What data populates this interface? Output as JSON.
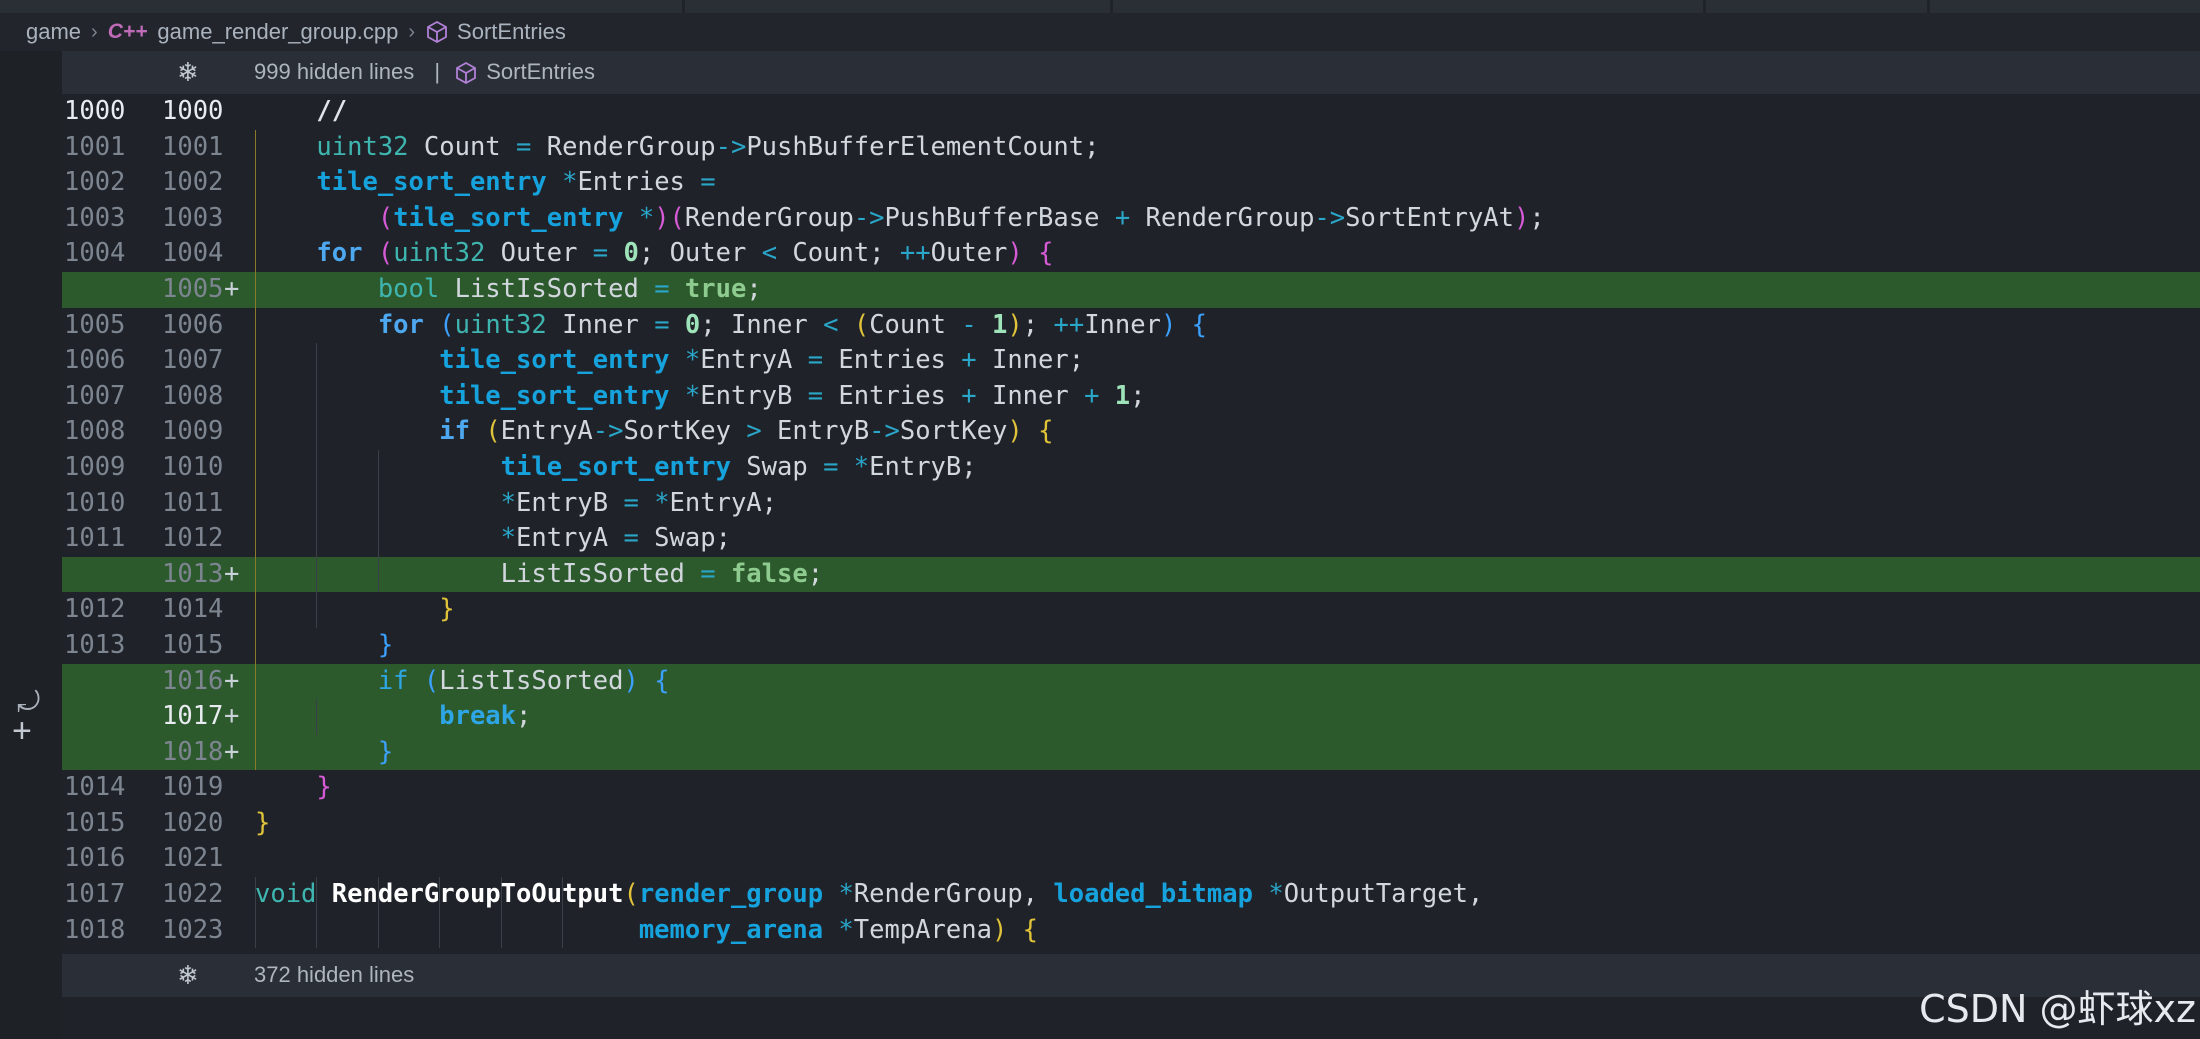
{
  "breadcrumb": {
    "folder": "game",
    "file": "game_render_group.cpp",
    "symbol": "SortEntries",
    "file_icon": "c++-icon",
    "symbol_icon": "cube-icon"
  },
  "fold_top": {
    "label": "999 hidden lines",
    "separator": "|",
    "context": "SortEntries"
  },
  "fold_bottom": {
    "label": "372 hidden lines"
  },
  "code_lines": [
    {
      "old": "1000",
      "new": "1000",
      "added": false,
      "active": true
    },
    {
      "old": "1001",
      "new": "1001",
      "added": false
    },
    {
      "old": "1002",
      "new": "1002",
      "added": false
    },
    {
      "old": "1003",
      "new": "1003",
      "added": false
    },
    {
      "old": "1004",
      "new": "1004",
      "added": false
    },
    {
      "old": "",
      "new": "1005",
      "added": true
    },
    {
      "old": "1005",
      "new": "1006",
      "added": false
    },
    {
      "old": "1006",
      "new": "1007",
      "added": false
    },
    {
      "old": "1007",
      "new": "1008",
      "added": false
    },
    {
      "old": "1008",
      "new": "1009",
      "added": false
    },
    {
      "old": "1009",
      "new": "1010",
      "added": false
    },
    {
      "old": "1010",
      "new": "1011",
      "added": false
    },
    {
      "old": "1011",
      "new": "1012",
      "added": false
    },
    {
      "old": "",
      "new": "1013",
      "added": true
    },
    {
      "old": "1012",
      "new": "1014",
      "added": false
    },
    {
      "old": "1013",
      "new": "1015",
      "added": false
    },
    {
      "old": "",
      "new": "1016",
      "added": true
    },
    {
      "old": "",
      "new": "1017",
      "added": true,
      "active": true
    },
    {
      "old": "",
      "new": "1018",
      "added": true
    },
    {
      "old": "1014",
      "new": "1019",
      "added": false
    },
    {
      "old": "1015",
      "new": "1020",
      "added": false
    },
    {
      "old": "1016",
      "new": "1021",
      "added": false
    },
    {
      "old": "1017",
      "new": "1022",
      "added": false
    },
    {
      "old": "1018",
      "new": "1023",
      "added": false
    }
  ],
  "plus_marker": "+",
  "watermark": "CSDN @虾球xz",
  "colors": {
    "added_bg": "#2d5a2d",
    "keyword": "#4da8f0",
    "type": "#16a3dd",
    "bool": "#8ecb8e"
  }
}
